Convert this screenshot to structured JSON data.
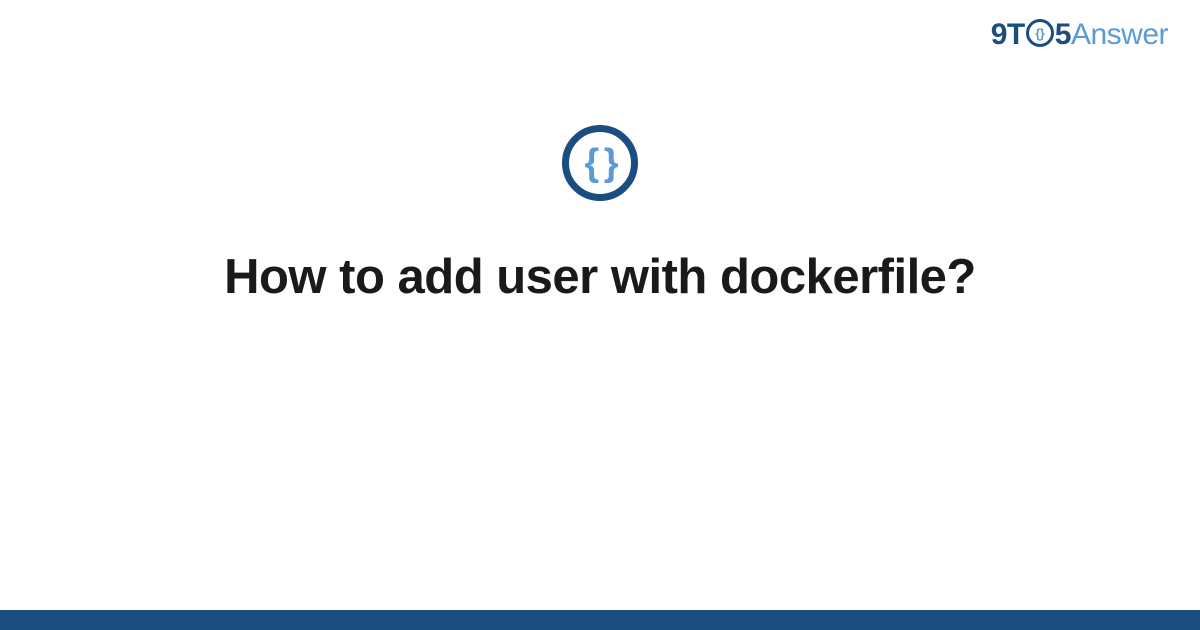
{
  "logo": {
    "part1": "9T",
    "circle_content": "{}",
    "part2": "5",
    "part3": "Answer"
  },
  "icon": {
    "braces": "{ }"
  },
  "title": "How to add user with dockerfile?",
  "colors": {
    "primary_dark": "#1a4d80",
    "primary_light": "#5a9bd5",
    "text": "#1a1a1a",
    "background": "#ffffff"
  }
}
